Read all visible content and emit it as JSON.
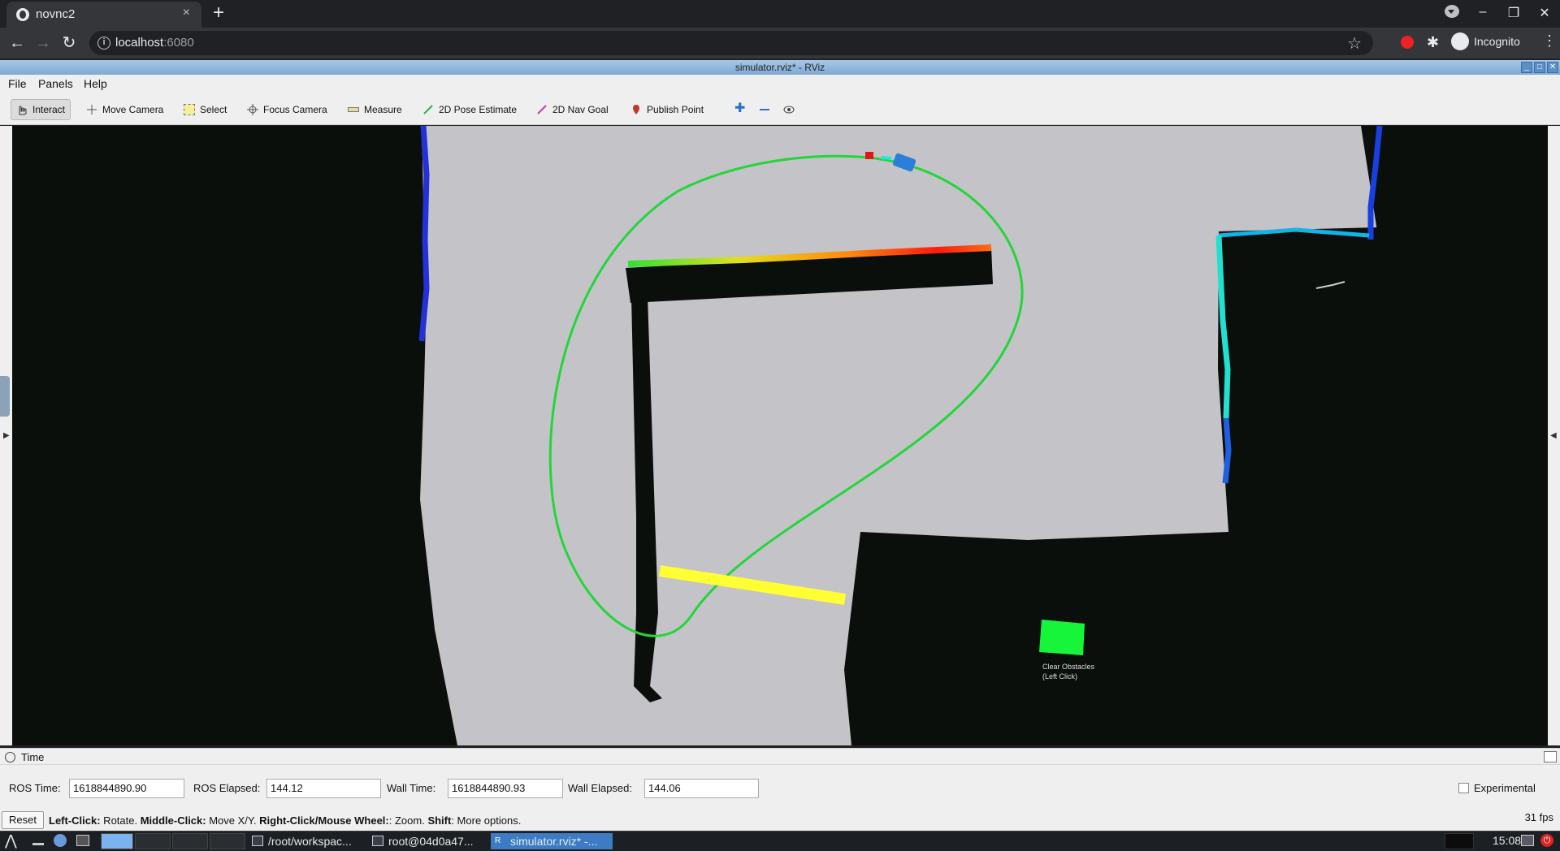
{
  "browser": {
    "tab_title": "novnc2",
    "tab_close_icon": "×",
    "new_tab_icon": "+",
    "url_host": "localhost",
    "url_port": ":6080",
    "incognito_label": "Incognito"
  },
  "rviz": {
    "window_title": "simulator.rviz* - RViz",
    "menu": [
      "File",
      "Panels",
      "Help"
    ],
    "tools": {
      "interact": "Interact",
      "move_camera": "Move Camera",
      "select": "Select",
      "focus_camera": "Focus Camera",
      "measure": "Measure",
      "pose_estimate": "2D Pose Estimate",
      "nav_goal": "2D Nav Goal",
      "publish_point": "Publish Point"
    },
    "viewport": {
      "obstacle_label_1": "Clear Obstacles",
      "obstacle_label_2": "(Left Click)",
      "colors": {
        "background": "#c4c3c8",
        "occupied": "#0a0f0b",
        "path": "#22d63a",
        "laser_segment": "#ffff33",
        "goal": "#16f53a",
        "robot": "#2b7fd8"
      }
    },
    "time_panel": {
      "title": "Time",
      "ros_time_label": "ROS Time:",
      "ros_time_value": "1618844890.90",
      "ros_elapsed_label": "ROS Elapsed:",
      "ros_elapsed_value": "144.12",
      "wall_time_label": "Wall Time:",
      "wall_time_value": "1618844890.93",
      "wall_elapsed_label": "Wall Elapsed:",
      "wall_elapsed_value": "144.06",
      "experimental_label": "Experimental"
    },
    "status": {
      "reset_label": "Reset",
      "hint_parts": [
        {
          "bold": "Left-Click:",
          "text": " Rotate. "
        },
        {
          "bold": "Middle-Click:",
          "text": " Move X/Y. "
        },
        {
          "bold": "Right-Click/Mouse Wheel:",
          "text": ": Zoom. "
        },
        {
          "bold": "Shift",
          "text": ": More options."
        }
      ],
      "fps": "31 fps"
    }
  },
  "taskbar": {
    "items": [
      "/root/workspac...",
      "root@04d0a47...",
      "simulator.rviz* -..."
    ],
    "clock": "15:08"
  }
}
